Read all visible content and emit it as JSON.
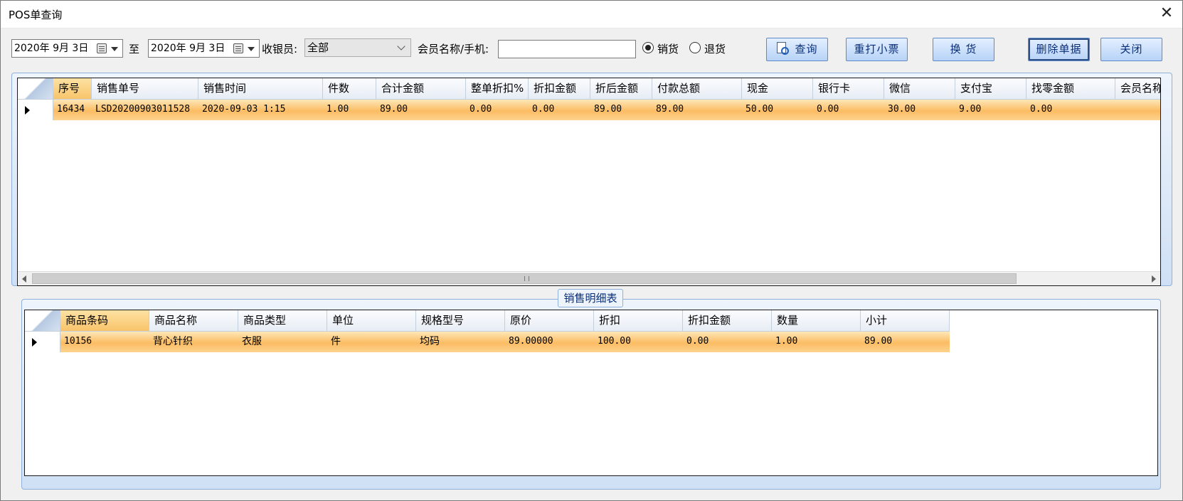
{
  "window": {
    "title": "POS单查询",
    "close_glyph": "✕"
  },
  "toolbar": {
    "date_from": "2020年 9月 3日",
    "to_label": "至",
    "date_to": "2020年 9月 3日",
    "cashier_label": "收银员:",
    "cashier_value": "全部",
    "member_label": "会员名称/手机:",
    "member_value": "",
    "radio_sale": "销货",
    "radio_return": "退货",
    "selected_radio": "销货",
    "btn_query": "查询",
    "btn_reprint": "重打小票",
    "btn_exchange": "换 货",
    "btn_delete": "删除单据",
    "btn_close": "关闭"
  },
  "orders": {
    "columns": [
      "序号",
      "销售单号",
      "销售时间",
      "件数",
      "合计金额",
      "整单折扣%",
      "折扣金额",
      "折后金额",
      "付款总额",
      "现金",
      "银行卡",
      "微信",
      "支付宝",
      "找零金额",
      "会员名称"
    ],
    "rows": [
      [
        "16434",
        "LSD20200903011528",
        "2020-09-03 1:15",
        "1.00",
        "89.00",
        "0.00",
        "0.00",
        "89.00",
        "89.00",
        "50.00",
        "0.00",
        "30.00",
        "9.00",
        "0.00",
        ""
      ]
    ]
  },
  "details": {
    "group_title": "销售明细表",
    "columns": [
      "商品条码",
      "商品名称",
      "商品类型",
      "单位",
      "规格型号",
      "原价",
      "折扣",
      "折扣金额",
      "数量",
      "小计"
    ],
    "rows": [
      [
        "10156",
        "背心针织",
        "衣服",
        "件",
        "均码",
        "89.00000",
        "100.00",
        "0.00",
        "1.00",
        "89.00"
      ]
    ]
  },
  "icons": {
    "query": "magnifier-document-icon",
    "calendar": "calendar-icon",
    "row_pointer": "row-pointer-icon"
  },
  "colors": {
    "selected_row": "#fbbc63",
    "button_text": "#0a2e78",
    "panel_border": "#8fb1db"
  }
}
